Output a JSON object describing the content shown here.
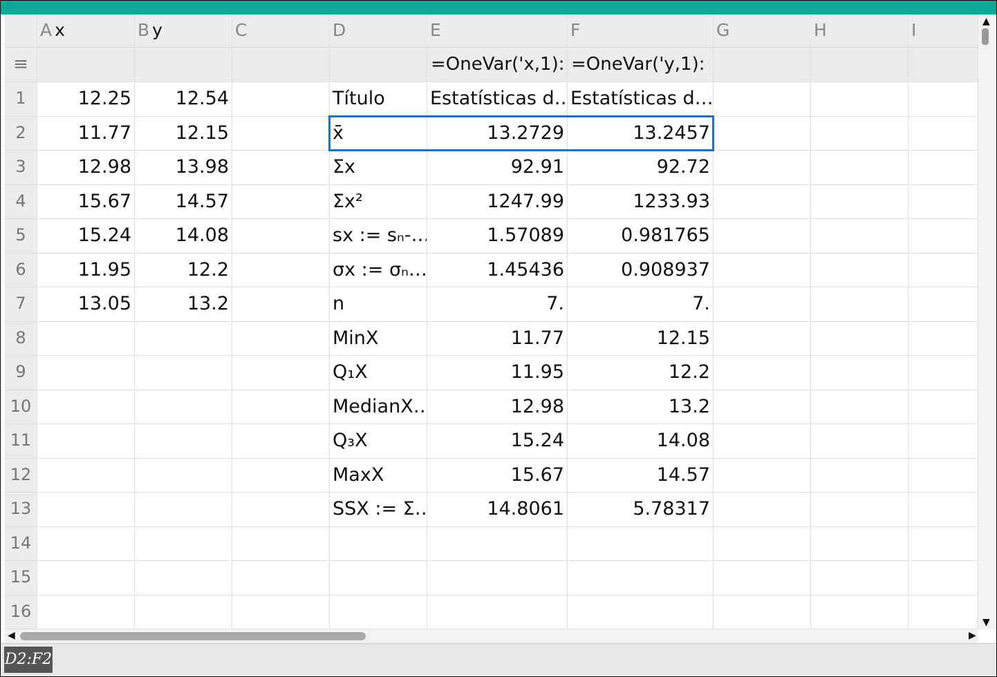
{
  "columns": [
    {
      "letter": "A",
      "name": "x"
    },
    {
      "letter": "B",
      "name": "y"
    },
    {
      "letter": "C",
      "name": ""
    },
    {
      "letter": "D",
      "name": ""
    },
    {
      "letter": "E",
      "name": ""
    },
    {
      "letter": "F",
      "name": ""
    },
    {
      "letter": "G",
      "name": ""
    },
    {
      "letter": "H",
      "name": ""
    },
    {
      "letter": "I",
      "name": ""
    }
  ],
  "formula_row": {
    "icon": "≡",
    "cells": [
      "",
      "",
      "",
      "",
      "=OneVar('x,1):",
      "=OneVar('y,1):",
      "",
      "",
      ""
    ]
  },
  "rows": [
    {
      "num": "1",
      "cells": [
        "12.25",
        "12.54",
        "",
        "Título",
        "Estatísticas d…",
        "Estatísticas d…",
        "",
        "",
        ""
      ]
    },
    {
      "num": "2",
      "cells": [
        "11.77",
        "12.15",
        "",
        "x̄",
        "13.2729",
        "13.2457",
        "",
        "",
        ""
      ]
    },
    {
      "num": "3",
      "cells": [
        "12.98",
        "13.98",
        "",
        "Σx",
        "92.91",
        "92.72",
        "",
        "",
        ""
      ]
    },
    {
      "num": "4",
      "cells": [
        "15.67",
        "14.57",
        "",
        "Σx²",
        "1247.99",
        "1233.93",
        "",
        "",
        ""
      ]
    },
    {
      "num": "5",
      "cells": [
        "15.24",
        "14.08",
        "",
        "sx := sₙ-…",
        "1.57089",
        "0.981765",
        "",
        "",
        ""
      ]
    },
    {
      "num": "6",
      "cells": [
        "11.95",
        "12.2",
        "",
        "σx := σₙ…",
        "1.45436",
        "0.908937",
        "",
        "",
        ""
      ]
    },
    {
      "num": "7",
      "cells": [
        "13.05",
        "13.2",
        "",
        "n",
        "7.",
        "7.",
        "",
        "",
        ""
      ]
    },
    {
      "num": "8",
      "cells": [
        "",
        "",
        "",
        "MinX",
        "11.77",
        "12.15",
        "",
        "",
        ""
      ]
    },
    {
      "num": "9",
      "cells": [
        "",
        "",
        "",
        "Q₁X",
        "11.95",
        "12.2",
        "",
        "",
        ""
      ]
    },
    {
      "num": "10",
      "cells": [
        "",
        "",
        "",
        "MedianX…",
        "12.98",
        "13.2",
        "",
        "",
        ""
      ]
    },
    {
      "num": "11",
      "cells": [
        "",
        "",
        "",
        "Q₃X",
        "15.24",
        "14.08",
        "",
        "",
        ""
      ]
    },
    {
      "num": "12",
      "cells": [
        "",
        "",
        "",
        "MaxX",
        "15.67",
        "14.57",
        "",
        "",
        ""
      ]
    },
    {
      "num": "13",
      "cells": [
        "",
        "",
        "",
        "SSX := Σ…",
        "14.8061",
        "5.78317",
        "",
        "",
        ""
      ]
    },
    {
      "num": "14",
      "cells": [
        "",
        "",
        "",
        "",
        "",
        "",
        "",
        "",
        ""
      ]
    },
    {
      "num": "15",
      "cells": [
        "",
        "",
        "",
        "",
        "",
        "",
        "",
        "",
        ""
      ]
    },
    {
      "num": "16",
      "cells": [
        "",
        "",
        "",
        "",
        "",
        "",
        "",
        "",
        ""
      ]
    }
  ],
  "status": {
    "cell_reference": "D2:F2"
  },
  "scroll_icons": {
    "up": "▲",
    "down": "▼",
    "left": "◀",
    "right": "▶"
  },
  "colors": {
    "top_bar": "#08a89a",
    "selection": "#1e6fd0"
  }
}
